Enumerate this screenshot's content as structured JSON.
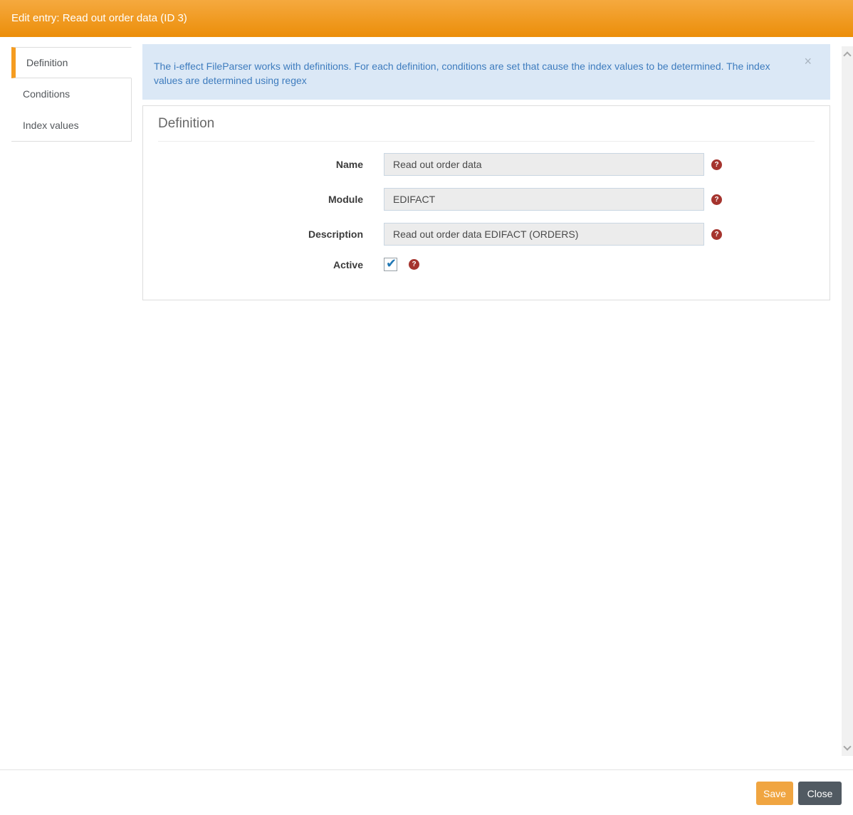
{
  "header": {
    "title": "Edit entry: Read out order data (ID 3)"
  },
  "sidebar": {
    "tabs": [
      {
        "label": "Definition",
        "active": true
      },
      {
        "label": "Conditions",
        "active": false
      },
      {
        "label": "Index values",
        "active": false
      }
    ]
  },
  "alert": {
    "text": "The i-effect FileParser works with definitions. For each definition, conditions are set that cause the index values to be determined. The index values are determined using regex"
  },
  "panel": {
    "title": "Definition",
    "fields": [
      {
        "label": "Name",
        "type": "text",
        "value": "Read out order data"
      },
      {
        "label": "Module",
        "type": "text",
        "value": "EDIFACT"
      },
      {
        "label": "Description",
        "type": "text",
        "value": "Read out order data EDIFACT (ORDERS)"
      },
      {
        "label": "Active",
        "type": "checkbox",
        "checked": true
      }
    ]
  },
  "footer": {
    "save_label": "Save",
    "close_label": "Close"
  },
  "glyphs": {
    "help": "?",
    "check": "✔",
    "close": "×"
  },
  "colors": {
    "header_top": "#f5a93f",
    "header_bottom": "#ec8e09",
    "accent_orange": "#f59c20",
    "save_bg": "#f0a541",
    "close_bg": "#515a62",
    "alert_bg": "#dbe8f6",
    "alert_text": "#3e7cbe",
    "help_bg": "#a5342e",
    "check_color": "#2178b5",
    "input_bg": "#ececec",
    "input_border": "#c9d6e2",
    "border_gray": "#dddddd"
  }
}
